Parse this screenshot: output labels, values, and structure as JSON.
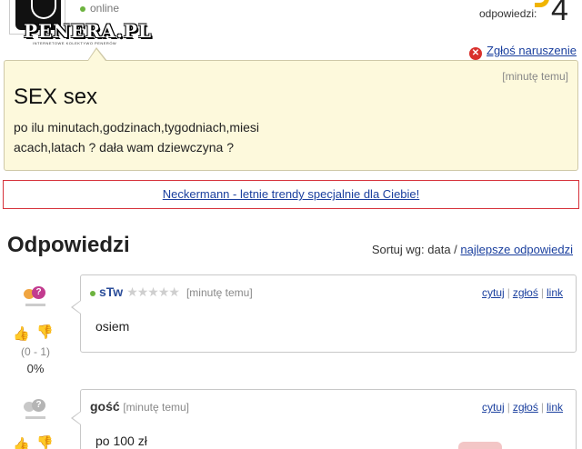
{
  "header": {
    "status": "online",
    "watermark": "PENERA.PL",
    "watermark_sub": "INTERNETOWE KOLEKTYWO PENERÓW",
    "answers_label": "odpowiedzi:",
    "answers_count": "4"
  },
  "report": {
    "label": "Zgłoś naruszenie",
    "icon": "x-circle-icon"
  },
  "question": {
    "time": "[minutę temu]",
    "title": "SEX sex",
    "body_line1": "po ilu minutach,godzinach,tygodniach,miesi",
    "body_line2": "acach,latach ? dała wam dziewczyna ?"
  },
  "ad": {
    "text": "Neckermann - letnie trendy specjalnie dla Ciebie!"
  },
  "answers_section": {
    "title": "Odpowiedzi",
    "sort_label": "Sortuj wg: data / ",
    "sort_link": "najlepsze odpowiedzi"
  },
  "answers": [
    {
      "author": "sTw",
      "stars": "★★★★★",
      "time": "[minutę temu]",
      "actions": {
        "quote": "cytuj",
        "report": "zgłoś",
        "link": "link"
      },
      "text": "osiem",
      "score": "(0 - 1)",
      "percent": "0%"
    },
    {
      "author": "gość",
      "time": "[minutę temu]",
      "actions": {
        "quote": "cytuj",
        "report": "zgłoś",
        "link": "link"
      },
      "text": "po 100 zł"
    }
  ],
  "colors": {
    "question_bg": "#fdf9dc",
    "link": "#1a3f9e",
    "ad_border": "#d6323b",
    "online": "#6db33f"
  }
}
